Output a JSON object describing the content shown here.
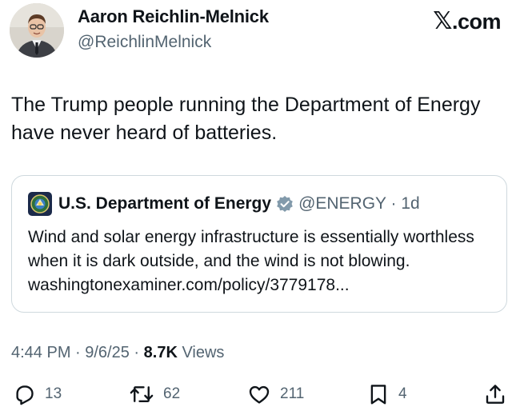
{
  "author": {
    "name": "Aaron Reichlin-Melnick",
    "handle": "@ReichlinMelnick"
  },
  "brand": {
    "x_glyph": "𝕏",
    "suffix": ".com"
  },
  "tweet": {
    "text": "The Trump people running the Department of Energy have never heard of batteries."
  },
  "quoted_tweet": {
    "name": "U.S. Department of Energy",
    "handle_time": "@ENERGY · 1d",
    "text": "Wind and solar energy infrastructure is essentially worthless when it is dark outside, and the wind is not blowing. washingtonexaminer.com/policy/3779178..."
  },
  "meta": {
    "timestamp": "4:44 PM · 9/6/25 · ",
    "views_count": "8.7K",
    "views_label": " Views"
  },
  "actions": {
    "replies": "13",
    "reposts": "62",
    "likes": "211",
    "bookmarks": "4"
  },
  "icons": {
    "reply": "reply-icon",
    "repost": "repost-icon",
    "like": "heart-icon",
    "bookmark": "bookmark-icon",
    "share": "share-icon",
    "verified": "verified-badge-icon"
  },
  "colors": {
    "text": "#0f1419",
    "secondary": "#536471",
    "border": "#cfd9de",
    "verified_gray": "#829aab"
  }
}
